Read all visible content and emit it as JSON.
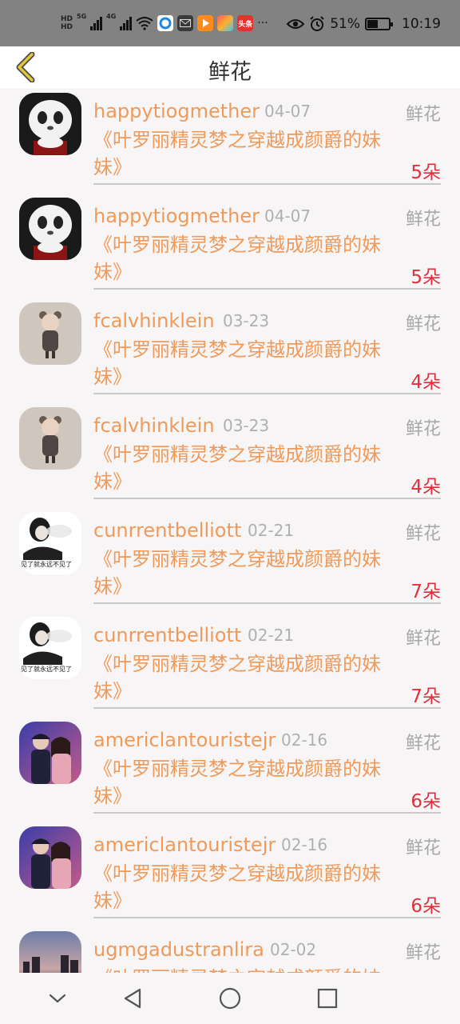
{
  "status_bar": {
    "hd_top": "HD",
    "hd_bottom": "HD",
    "net1": "5G",
    "net2": "4G",
    "more": "···",
    "battery": "51%",
    "battery_level": 0.51,
    "time": "10:19",
    "app_badge_text": "头条"
  },
  "header": {
    "title": "鲜花"
  },
  "list": {
    "items": [
      {
        "user": "happytiogmether",
        "date": "04-07",
        "label": "鲜花",
        "book": "《叶罗丽精灵梦之穿越成颜爵的妹妹》",
        "count": "5朵",
        "avatar": "panda"
      },
      {
        "user": "happytiogmether",
        "date": "04-07",
        "label": "鲜花",
        "book": "《叶罗丽精灵梦之穿越成颜爵的妹妹》",
        "count": "5朵",
        "avatar": "panda"
      },
      {
        "user": "fcalvhinklein",
        "date": "03-23",
        "label": "鲜花",
        "book": "《叶罗丽精灵梦之穿越成颜爵的妹妹》",
        "count": "4朵",
        "avatar": "child"
      },
      {
        "user": "fcalvhinklein",
        "date": "03-23",
        "label": "鲜花",
        "book": "《叶罗丽精灵梦之穿越成颜爵的妹妹》",
        "count": "4朵",
        "avatar": "child"
      },
      {
        "user": "cunrrentbelliott",
        "date": "02-21",
        "label": "鲜花",
        "book": "《叶罗丽精灵梦之穿越成颜爵的妹妹》",
        "count": "7朵",
        "avatar": "smoke",
        "avatar_text": "见了就永远不见了"
      },
      {
        "user": "cunrrentbelliott",
        "date": "02-21",
        "label": "鲜花",
        "book": "《叶罗丽精灵梦之穿越成颜爵的妹妹》",
        "count": "7朵",
        "avatar": "smoke",
        "avatar_text": "见了就永远不见了"
      },
      {
        "user": "americlantouristejr",
        "date": "02-16",
        "label": "鲜花",
        "book": "《叶罗丽精灵梦之穿越成颜爵的妹妹》",
        "count": "6朵",
        "avatar": "couple"
      },
      {
        "user": "americlantouristejr",
        "date": "02-16",
        "label": "鲜花",
        "book": "《叶罗丽精灵梦之穿越成颜爵的妹妹》",
        "count": "6朵",
        "avatar": "couple"
      },
      {
        "user": "ugmgadustranlira",
        "date": "02-02",
        "label": "鲜花",
        "book": "《叶罗丽精灵梦之穿越成颜爵的妹妹》",
        "count": "",
        "avatar": "city"
      }
    ]
  },
  "nav_bar": {
    "icons": [
      "chevron-down-icon",
      "back-triangle-icon",
      "home-circle-icon",
      "recents-square-icon"
    ]
  },
  "colors": {
    "accent": "#f09a5a",
    "count": "#e0303c",
    "back_icon": "#e0c83a",
    "status_bar_bg": "#828282"
  }
}
